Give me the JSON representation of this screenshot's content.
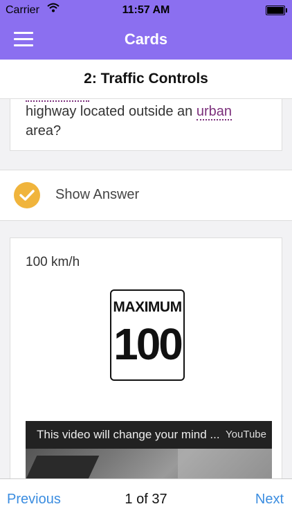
{
  "status_bar": {
    "carrier": "Carrier",
    "time": "11:57 AM"
  },
  "nav": {
    "title": "Cards",
    "menu_icon": "hamburger-menu-icon"
  },
  "section": {
    "title": "2: Traffic Controls"
  },
  "question": {
    "line1": "highway located outside an ",
    "term": "urban",
    "line2": "area?"
  },
  "show_answer": {
    "label": "Show Answer",
    "icon": "checkmark-icon",
    "icon_color": "#f0b43c"
  },
  "answer": {
    "text": "100 km/h",
    "sign_top": "MAXIMUM",
    "sign_number": "100"
  },
  "video": {
    "title": "This video will change your mind ...",
    "source": "YouTube"
  },
  "pagination": {
    "previous": "Previous",
    "next": "Next",
    "indicator": "1 of 37"
  },
  "colors": {
    "nav_bg": "#8b6ff0",
    "link": "#3b8de0",
    "term": "#7b2f7b"
  }
}
